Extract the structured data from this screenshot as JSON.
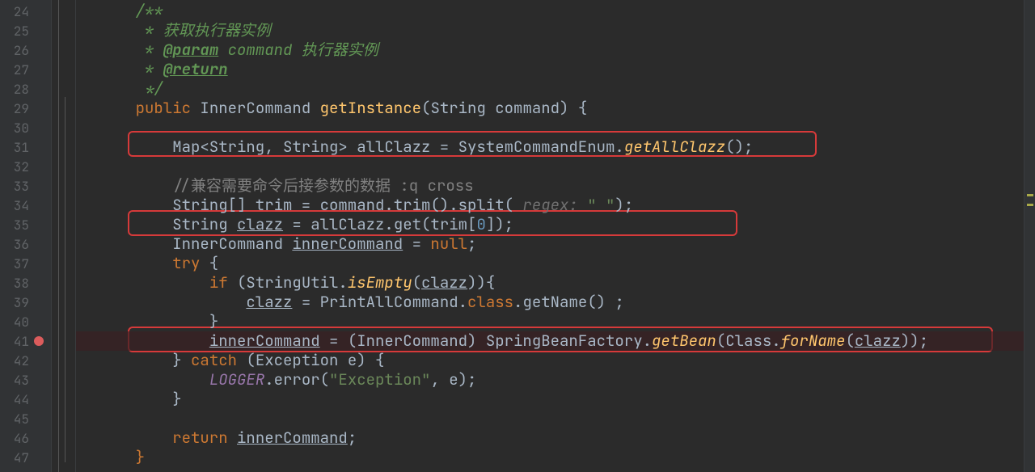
{
  "gutter": {
    "lines": [
      "24",
      "25",
      "26",
      "27",
      "28",
      "29",
      "30",
      "31",
      "32",
      "33",
      "34",
      "35",
      "36",
      "37",
      "38",
      "39",
      "40",
      "41",
      "42",
      "43",
      "44",
      "45",
      "46",
      "47"
    ],
    "breakpointLine": "41"
  },
  "code": {
    "l24": {
      "c1": "/**"
    },
    "l25": {
      "c1": " * 获取执行器实例"
    },
    "l26": {
      "c1": " * ",
      "tag": "@param",
      "p": " command",
      "rest": " 执行器实例"
    },
    "l27": {
      "c1": " * ",
      "tag": "@return"
    },
    "l28": {
      "c1": " */"
    },
    "l29": {
      "kw1": "public",
      "ty1": " InnerCommand ",
      "m1": "getInstance",
      "p1": "(",
      "ty2": "String",
      "p2": " command) ",
      "br": "{"
    },
    "l31": {
      "ty1": "Map<String, String> allClazz = SystemCommandEnum.",
      "m1": "getAllClazz",
      "p1": "();"
    },
    "l33": {
      "c1": "//兼容需要命令后接参数的数据 :q cross"
    },
    "l34": {
      "t1": "String[] trim = command.trim().split( ",
      "hint": "regex: ",
      "s1": "\" \"",
      "t2": ");"
    },
    "l35": {
      "t1": "String ",
      "v1": "clazz",
      "t2": " = allClazz.get(trim[",
      "n1": "0",
      "t3": "]);"
    },
    "l36": {
      "t1": "InnerCommand ",
      "v1": "innerCommand",
      "t2": " = ",
      "kw": "null",
      "t3": ";"
    },
    "l37": {
      "kw": "try",
      "t1": " {"
    },
    "l38": {
      "kw": "if",
      "t1": " (StringUtil.",
      "m1": "isEmpty",
      "t2": "(",
      "v1": "clazz",
      "t3": ")){"
    },
    "l39": {
      "v1": "clazz",
      "t1": " = PrintAllCommand.",
      "kw": "class",
      "t2": ".getName() ;"
    },
    "l40": {
      "t1": "}"
    },
    "l41": {
      "v1": "innerCommand",
      "t1": " = (InnerCommand) SpringBeanFactory.",
      "m1": "getBean",
      "t2": "(Class.",
      "m2": "forName",
      "t3": "(",
      "v2": "clazz",
      "t4": "));"
    },
    "l42": {
      "t1": "} ",
      "kw": "catch",
      "t2": " (Exception e) {"
    },
    "l43": {
      "f1": "LOGGER",
      "t1": ".error(",
      "s1": "\"Exception\"",
      "t2": ", e);"
    },
    "l44": {
      "t1": "}"
    },
    "l46": {
      "kw": "return",
      "t1": " ",
      "v1": "innerCommand",
      "t2": ";"
    },
    "l47": {
      "t1": "}"
    }
  }
}
